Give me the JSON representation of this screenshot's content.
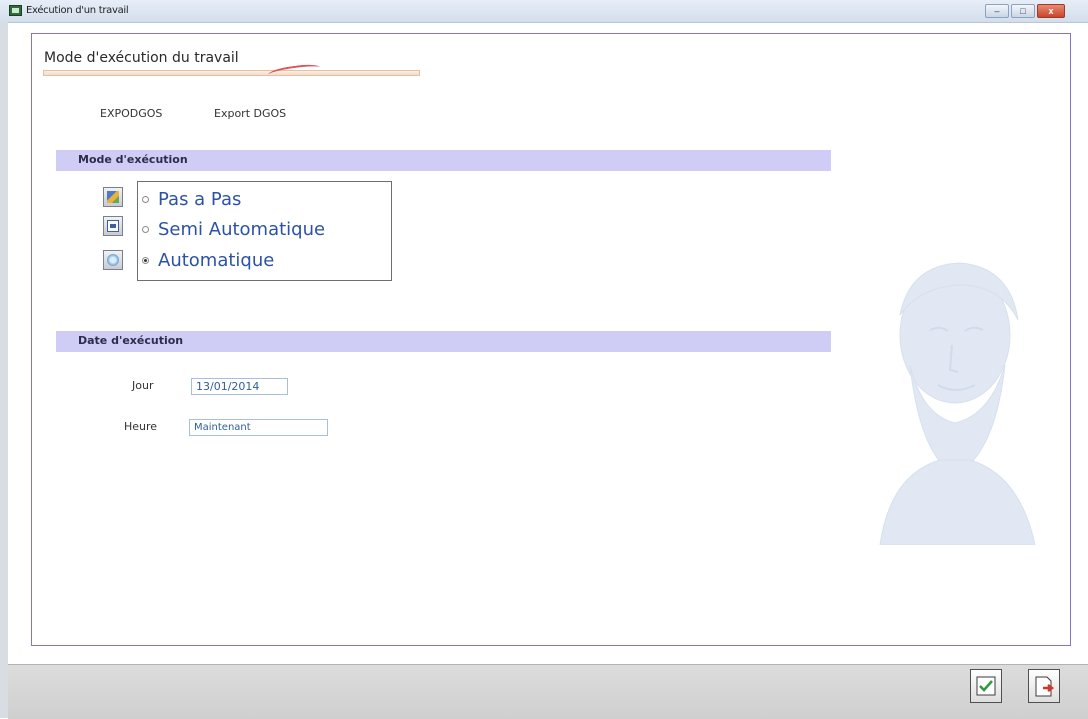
{
  "window": {
    "title": "Exécution d'un travail",
    "controls": {
      "minimize": "–",
      "maximize": "□",
      "close": "x"
    }
  },
  "panel": {
    "title": "Mode d'exécution du travail",
    "job": {
      "code": "EXPODGOS",
      "label": "Export DGOS"
    }
  },
  "mode_section": {
    "title": "Mode d'exécution",
    "options": [
      {
        "label": "Pas a Pas",
        "icon": "step-icon",
        "checked": false
      },
      {
        "label": "Semi Automatique",
        "icon": "semi-auto-icon",
        "checked": false
      },
      {
        "label": "Automatique",
        "icon": "auto-icon",
        "checked": true
      }
    ]
  },
  "date_section": {
    "title": "Date d'exécution",
    "day_label": "Jour",
    "day_value": "13/01/2014",
    "hour_label": "Heure",
    "hour_value": "Maintenant"
  },
  "toolbar": {
    "validate_icon": "check-icon",
    "cancel_icon": "exit-icon"
  },
  "colors": {
    "section_bar": "#cfcdf6",
    "panel_border": "#7f78c8",
    "radio_text": "#2c52a6"
  }
}
